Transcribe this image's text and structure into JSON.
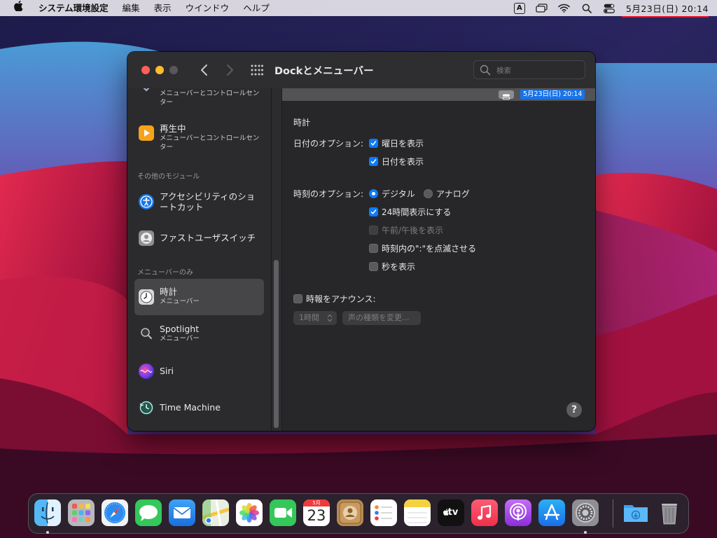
{
  "menubar": {
    "app_name": "システム環境設定",
    "items": [
      "編集",
      "表示",
      "ウインドウ",
      "ヘルプ"
    ],
    "input_badge": "A",
    "clock": "5月23日(日)  20:14"
  },
  "window": {
    "title": "Dockとメニューバー",
    "search_placeholder": "検索"
  },
  "sidebar": {
    "items": [
      {
        "title": "",
        "subtitle": "メニューバーとコントロールセンター"
      },
      {
        "title": "再生中",
        "subtitle": "メニューバーとコントロールセンター"
      },
      {
        "title": "アクセシビリティのショートカット",
        "subtitle": ""
      },
      {
        "title": "ファストユーザスイッチ",
        "subtitle": ""
      },
      {
        "title": "時計",
        "subtitle": "メニューバー"
      },
      {
        "title": "Spotlight",
        "subtitle": "メニューバー"
      },
      {
        "title": "Siri",
        "subtitle": ""
      },
      {
        "title": "Time Machine",
        "subtitle": ""
      }
    ],
    "headers": [
      "その他のモジュール",
      "メニューバーのみ"
    ],
    "selected": "時計"
  },
  "preview": {
    "clock": "5月23日(日)  20:14"
  },
  "clock_settings": {
    "section_title": "時計",
    "date_options_label": "日付のオプション:",
    "show_weekday": {
      "label": "曜日を表示",
      "checked": true
    },
    "show_date": {
      "label": "日付を表示",
      "checked": true
    },
    "time_options_label": "時刻のオプション:",
    "digital": {
      "label": "デジタル",
      "selected": true
    },
    "analog": {
      "label": "アナログ",
      "selected": false
    },
    "use_24h": {
      "label": "24時間表示にする",
      "checked": true
    },
    "show_ampm": {
      "label": "午前/午後を表示",
      "checked": false,
      "disabled": true
    },
    "flash_separators": {
      "label": "時刻内の\":\"を点滅させる",
      "checked": false
    },
    "show_seconds": {
      "label": "秒を表示",
      "checked": false
    },
    "announce_time": {
      "label": "時報をアナウンス:",
      "checked": false
    },
    "interval_popup": "1時間",
    "voice_button": "声の種類を変更..."
  },
  "help_label": "?",
  "dock": {
    "apps": [
      {
        "name": "finder-app",
        "running": true
      },
      {
        "name": "launchpad-app",
        "running": false
      },
      {
        "name": "safari-app",
        "running": false
      },
      {
        "name": "messages-app",
        "running": false
      },
      {
        "name": "mail-app",
        "running": false
      },
      {
        "name": "maps-app",
        "running": false
      },
      {
        "name": "photos-app",
        "running": false
      },
      {
        "name": "facetime-app",
        "running": false
      },
      {
        "name": "calendar-app",
        "running": false
      },
      {
        "name": "contacts-app",
        "running": false
      },
      {
        "name": "reminders-app",
        "running": false
      },
      {
        "name": "notes-app",
        "running": false
      },
      {
        "name": "tv-app",
        "running": false
      },
      {
        "name": "music-app",
        "running": false
      },
      {
        "name": "podcasts-app",
        "running": false
      },
      {
        "name": "app-store-app",
        "running": false
      },
      {
        "name": "system-preferences-app",
        "running": true
      }
    ],
    "calendar_month": "5月",
    "calendar_day": "23",
    "tv_label": "tv",
    "folders": [
      "downloads-folder",
      "trash"
    ]
  }
}
